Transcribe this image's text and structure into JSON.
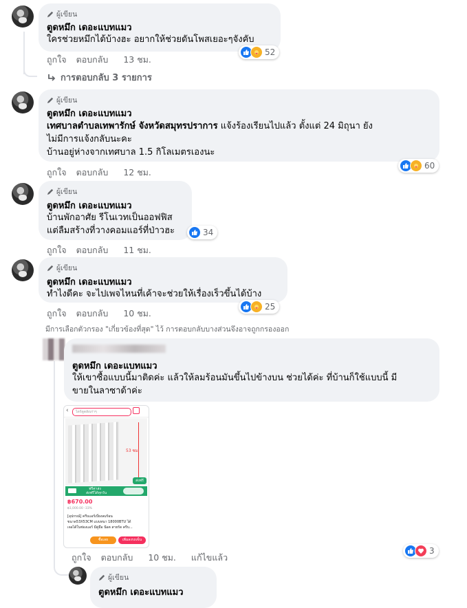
{
  "comments": [
    {
      "author_badge": "ผู้เขียน",
      "author": "ตูดหมึก เดอะแบทแมว",
      "lines": [
        "ใครช่วยหมึกได้บ้างฮะ อยากให้ช่วยดันโพสเยอะๆจังคับ"
      ],
      "actions": [
        "ถูกใจ",
        "ตอบกลับ"
      ],
      "time": "13 ชม.",
      "reaction_count": "52"
    },
    {
      "author_badge": "ผู้เขียน",
      "author": "ตูดหมึก เดอะแบทแมว",
      "bold_prefix": "เทศบาลตำบลเทพารักษ์ จังหวัดสมุทรปราการ",
      "lines": [
        " แจ้งร้องเรียนไปแล้ว ตั้งแต่ 24 มิถุนา ยัง",
        "ไม่มีการแจ้งกลับนะคะ",
        "บ้านอยู่ห่างจากเทศบาล 1.5 กิโลเมตรเองนะ"
      ],
      "actions": [
        "ถูกใจ",
        "ตอบกลับ"
      ],
      "time": "12 ชม.",
      "reaction_count": "60"
    },
    {
      "author_badge": "ผู้เขียน",
      "author": "ตูดหมึก เดอะแบทแมว",
      "lines": [
        "บ้านพักอาศัย รีโนเวทเป็นออฟฟิส",
        "แต่ลืมสร้างที่วางคอมแอร์ที่ป่าวฮะ"
      ],
      "actions": [
        "ถูกใจ",
        "ตอบกลับ"
      ],
      "time": "11 ชม.",
      "reaction_count": "34"
    },
    {
      "author_badge": "ผู้เขียน",
      "author": "ตูดหมึก เดอะแบทแมว",
      "lines": [
        "ทำไงดีคะ จะไปเพจไหนที่เค้าจะช่วยให้เรื่องเร็วขึ้นได้บ้าง"
      ],
      "actions": [
        "ถูกใจ",
        "ตอบกลับ"
      ],
      "time": "10 ชม.",
      "reaction_count": "25"
    }
  ],
  "replies_link": "การตอบกลับ 3 รายการ",
  "filter_notice": "มีการเลือกตัวกรอง \"เกี่ยวข้องที่สุด\" ไว้ การตอบกลับบางส่วนจึงอาจถูกกรองออก",
  "reply": {
    "mention": "ตูดหมึก เดอะแบทแมว",
    "lines": [
      "ให้เขาซื้อแบบนี้มาติดค่ะ แล้วให้ลมร้อนมันขึ้นไปข้างบน ช่วยได้ค่ะ ที่บ้านก็ใช้แบบนี้ มี",
      "ขายในลาซาด้าค่ะ"
    ],
    "actions": [
      "ถูกใจ",
      "ตอบกลับ"
    ],
    "time": "10 ชม.",
    "edited": "แก้ไขแล้ว",
    "reaction_count": "3",
    "product": {
      "search": "ไดร์ดูดลังเก่าๆ",
      "size_label": "53 ซม.",
      "free_ship": "ส่งฟรี",
      "shipping_line1": "ฟรีค่าส่ง",
      "shipping_line2": "ส่งฟรีได้ทุกวัน",
      "price": "฿670.00",
      "old_price": "฿1,000.00 -33%",
      "desc": [
        "[อุปกรณ์] ครีบแอร์เบี่ยงลมร้อน",
        "ขนาด53X53CM แบบหนา 18000BTU ได้",
        "เจอได้ในช่องแอร์ มีคู่มือ น๊อต สายรัด ครีบ..."
      ],
      "btn_left": "ซื้อเลย",
      "btn_right": "เพิ่มลงรถเข็น"
    }
  },
  "last_comment": {
    "author_badge": "ผู้เขียน",
    "author": "ตูดหมึก เดอะแบทแมว"
  },
  "colors": {
    "like": "#1877f2",
    "bubble": "#f0f2f5",
    "muted": "#65676b",
    "love": "#f33e58",
    "lazada_pink": "#f5305e",
    "lazada_green": "#23a86b"
  }
}
